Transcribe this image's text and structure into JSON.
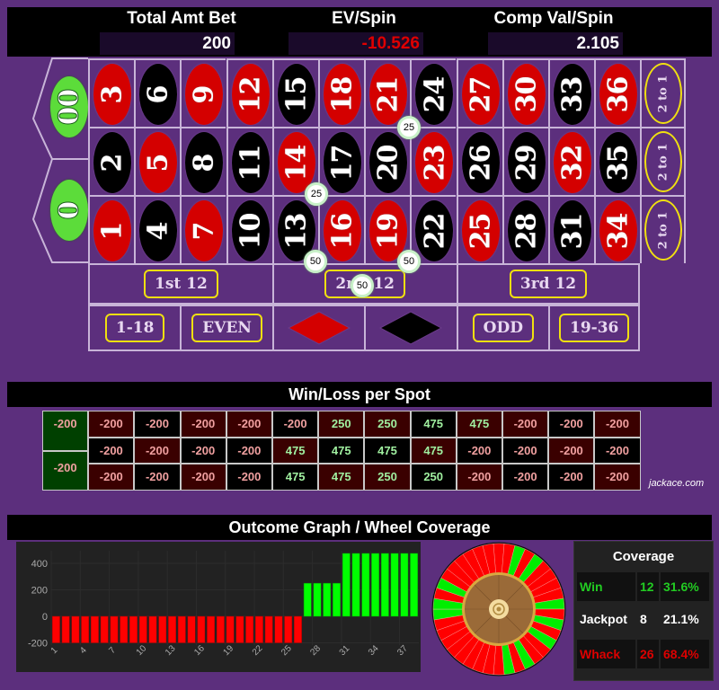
{
  "header": {
    "total_bet_label": "Total Amt Bet",
    "total_bet_value": "200",
    "ev_label": "EV/Spin",
    "ev_value": "-10.526",
    "comp_label": "Comp Val/Spin",
    "comp_value": "2.105"
  },
  "colors": {
    "felt": "#5c2f7d",
    "red": "#d40000",
    "black": "#000000",
    "green": "#5cdc3a",
    "win": "#00ff00",
    "loss": "#ff0000",
    "badge_border": "#f0e010"
  },
  "layout_table": {
    "zeros": [
      "00",
      "0"
    ],
    "rows": [
      [
        {
          "n": "3",
          "c": "red"
        },
        {
          "n": "6",
          "c": "black"
        },
        {
          "n": "9",
          "c": "red"
        },
        {
          "n": "12",
          "c": "red"
        },
        {
          "n": "15",
          "c": "black"
        },
        {
          "n": "18",
          "c": "red"
        },
        {
          "n": "21",
          "c": "red"
        },
        {
          "n": "24",
          "c": "black"
        },
        {
          "n": "27",
          "c": "red"
        },
        {
          "n": "30",
          "c": "red"
        },
        {
          "n": "33",
          "c": "black"
        },
        {
          "n": "36",
          "c": "red"
        }
      ],
      [
        {
          "n": "2",
          "c": "black"
        },
        {
          "n": "5",
          "c": "red"
        },
        {
          "n": "8",
          "c": "black"
        },
        {
          "n": "11",
          "c": "black"
        },
        {
          "n": "14",
          "c": "red"
        },
        {
          "n": "17",
          "c": "black"
        },
        {
          "n": "20",
          "c": "black"
        },
        {
          "n": "23",
          "c": "red"
        },
        {
          "n": "26",
          "c": "black"
        },
        {
          "n": "29",
          "c": "black"
        },
        {
          "n": "32",
          "c": "red"
        },
        {
          "n": "35",
          "c": "black"
        }
      ],
      [
        {
          "n": "1",
          "c": "red"
        },
        {
          "n": "4",
          "c": "black"
        },
        {
          "n": "7",
          "c": "red"
        },
        {
          "n": "10",
          "c": "black"
        },
        {
          "n": "13",
          "c": "black"
        },
        {
          "n": "16",
          "c": "red"
        },
        {
          "n": "19",
          "c": "red"
        },
        {
          "n": "22",
          "c": "black"
        },
        {
          "n": "25",
          "c": "red"
        },
        {
          "n": "28",
          "c": "black"
        },
        {
          "n": "31",
          "c": "black"
        },
        {
          "n": "34",
          "c": "red"
        }
      ]
    ],
    "column_bets": [
      "2 to 1",
      "2 to 1",
      "2 to 1"
    ],
    "dozens": [
      "1st 12",
      "2nd 12",
      "3rd 12"
    ],
    "even_money": [
      "1-18",
      "EVEN",
      "red-diamond",
      "black-diamond",
      "ODD",
      "19-36"
    ],
    "chips": [
      {
        "label": "25",
        "spot": "corner 20-21-23-24"
      },
      {
        "label": "25",
        "spot": "corner 13-14-16-17"
      },
      {
        "label": "50",
        "spot": "six-line 13-18"
      },
      {
        "label": "50",
        "spot": "six-line 19-24"
      },
      {
        "label": "50",
        "spot": "2nd 12"
      }
    ]
  },
  "winloss": {
    "title": "Win/Loss per Spot",
    "zeros": [
      {
        "label": "00",
        "value": "-200"
      },
      {
        "label": "0",
        "value": "-200"
      }
    ],
    "rows": [
      [
        "-200",
        "-200",
        "-200",
        "-200",
        "-200",
        "250",
        "250",
        "475",
        "475",
        "-200",
        "-200",
        "-200"
      ],
      [
        "-200",
        "-200",
        "-200",
        "-200",
        "475",
        "475",
        "475",
        "475",
        "-200",
        "-200",
        "-200",
        "-200"
      ],
      [
        "-200",
        "-200",
        "-200",
        "-200",
        "475",
        "475",
        "250",
        "250",
        "-200",
        "-200",
        "-200",
        "-200"
      ]
    ],
    "credit": "jackace.com"
  },
  "outcome": {
    "title": "Outcome Graph / Wheel Coverage"
  },
  "chart_data": {
    "type": "bar",
    "title": "Outcome Graph",
    "xlabel": "",
    "ylabel": "",
    "x_tick_labels": [
      "1",
      "4",
      "7",
      "10",
      "13",
      "16",
      "19",
      "22",
      "25",
      "28",
      "31",
      "34",
      "37"
    ],
    "categories": [
      "1",
      "2",
      "3",
      "4",
      "5",
      "6",
      "7",
      "8",
      "9",
      "10",
      "11",
      "12",
      "13",
      "14",
      "15",
      "16",
      "17",
      "18",
      "19",
      "20",
      "21",
      "22",
      "23",
      "24",
      "25",
      "26",
      "27",
      "28",
      "29",
      "30",
      "31",
      "32",
      "33",
      "34",
      "35",
      "36",
      "37",
      "38"
    ],
    "values": [
      -200,
      -200,
      -200,
      -200,
      -200,
      -200,
      -200,
      -200,
      -200,
      -200,
      -200,
      -200,
      -200,
      -200,
      -200,
      -200,
      -200,
      -200,
      -200,
      -200,
      -200,
      -200,
      -200,
      -200,
      -200,
      -200,
      250,
      250,
      250,
      250,
      475,
      475,
      475,
      475,
      475,
      475,
      475,
      475
    ],
    "y_ticks": [
      "400",
      "200",
      "0",
      "-200"
    ],
    "ylim": [
      -250,
      520
    ],
    "grid": true,
    "positive_color": "#00ff00",
    "negative_color": "#ff0000"
  },
  "wheel": {
    "segments": [
      "L",
      "L",
      "W",
      "L",
      "W",
      "L",
      "L",
      "L",
      "L",
      "W",
      "L",
      "W",
      "L",
      "W",
      "L",
      "L",
      "W",
      "L",
      "W",
      "L",
      "L",
      "L",
      "L",
      "L",
      "L",
      "L",
      "L",
      "L",
      "W",
      "W",
      "L",
      "W",
      "L",
      "L",
      "L",
      "L",
      "L",
      "L"
    ]
  },
  "coverage": {
    "title": "Coverage",
    "rows": [
      {
        "label": "Win",
        "count": "12",
        "pct": "31.6%",
        "color": "#22cc22"
      },
      {
        "label": "Jackpot",
        "count": "8",
        "pct": "21.1%",
        "color": "#ffffff"
      },
      {
        "label": "Whack",
        "count": "26",
        "pct": "68.4%",
        "color": "#dd0000"
      }
    ]
  }
}
